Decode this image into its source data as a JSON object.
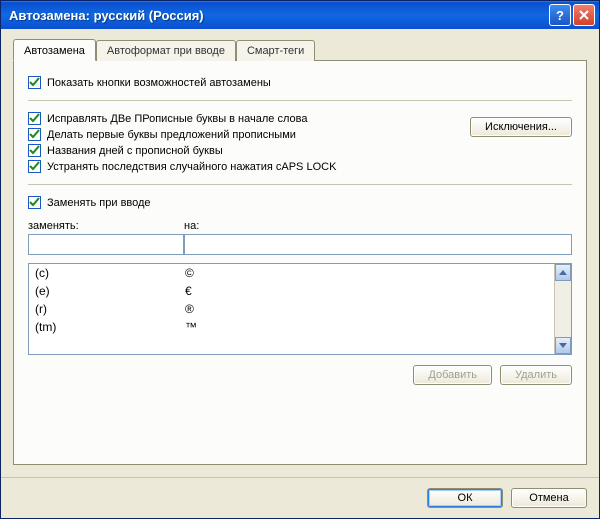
{
  "window": {
    "title": "Автозамена: русский (Россия)"
  },
  "tabs": {
    "t0": "Автозамена",
    "t1": "Автоформат при вводе",
    "t2": "Смарт-теги"
  },
  "checks": {
    "show_buttons": "Показать кнопки возможностей автозамены",
    "two_caps": "Исправлять ДВе ПРописные буквы в начале слова",
    "first_letter": "Делать первые буквы предложений прописными",
    "day_names": "Названия дней с прописной буквы",
    "caps_lock": "Устранять последствия случайного нажатия cAPS LOCK",
    "replace_on_type": "Заменять при вводе"
  },
  "buttons": {
    "exceptions": "Исключения...",
    "add": "Добавить",
    "delete": "Удалить",
    "ok": "ОК",
    "cancel": "Отмена"
  },
  "labels": {
    "replace": "заменять:",
    "with": "на:"
  },
  "rows": {
    "r0": {
      "from": "(c)",
      "to": "©"
    },
    "r1": {
      "from": "(e)",
      "to": "€"
    },
    "r2": {
      "from": "(r)",
      "to": "®"
    },
    "r3": {
      "from": "(tm)",
      "to": "™"
    }
  }
}
